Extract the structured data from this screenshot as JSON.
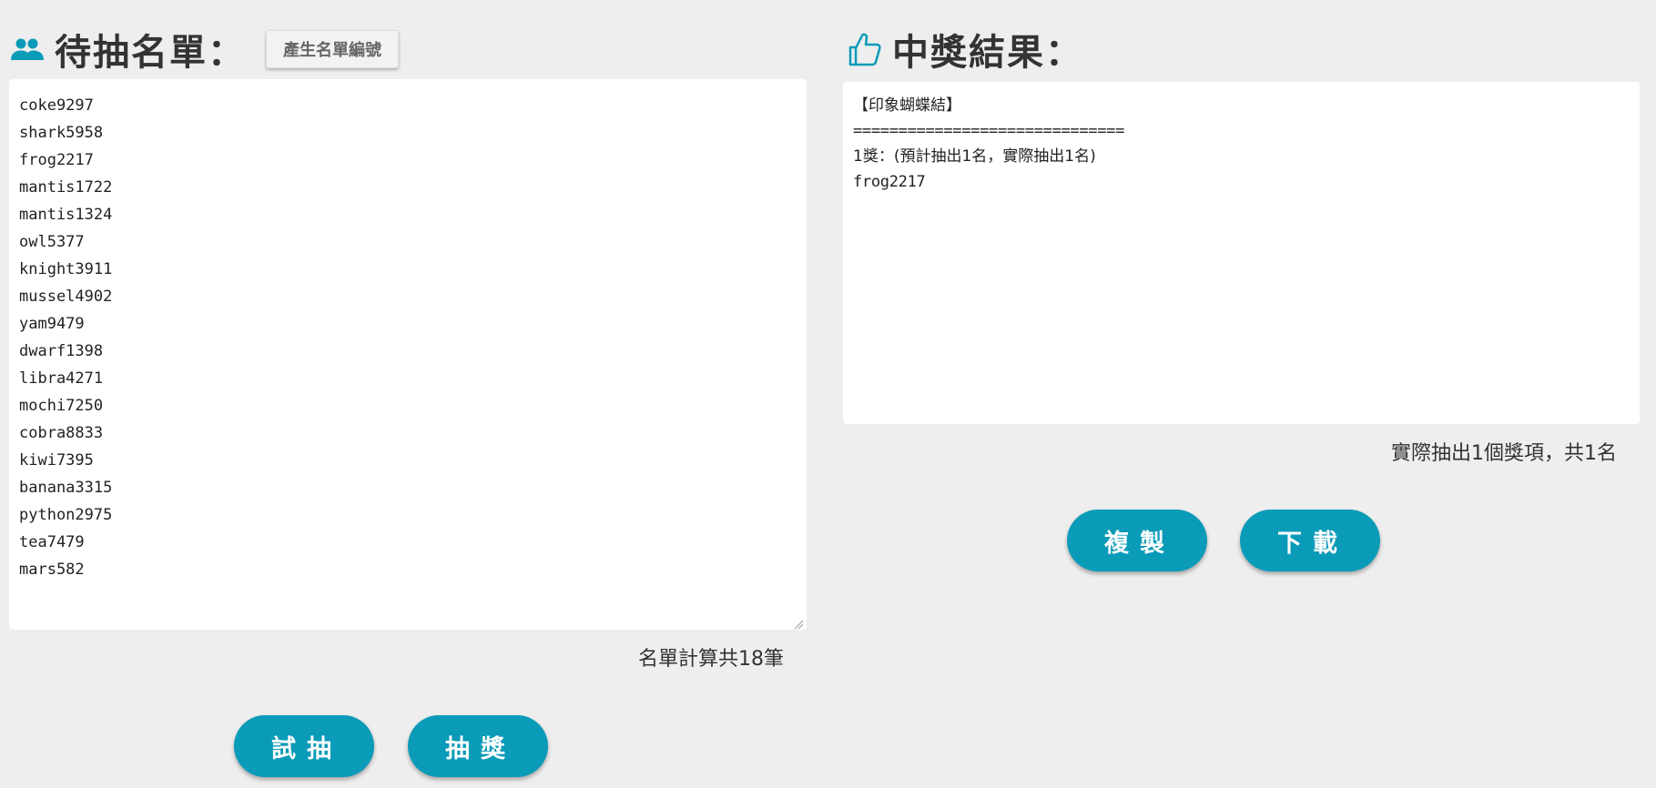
{
  "colors": {
    "accent": "#0a9bb8",
    "background": "#eeeeee",
    "box": "#ffffff"
  },
  "left": {
    "icon": "people-icon",
    "title": "待抽名單：",
    "generate_button": "產生名單編號",
    "names": [
      "coke9297",
      "shark5958",
      "frog2217",
      "mantis1722",
      "mantis1324",
      "owl5377",
      "knight3911",
      "mussel4902",
      "yam9479",
      "dwarf1398",
      "libra4271",
      "mochi7250",
      "cobra8833",
      "kiwi7395",
      "banana3315",
      "python2975",
      "tea7479",
      "mars582"
    ],
    "count_text": "名單計算共18筆",
    "try_button": "試抽",
    "draw_button": "抽獎"
  },
  "right": {
    "icon": "thumbs-up-icon",
    "title": "中獎結果：",
    "result_lines": [
      "【印象蝴蝶結】",
      "==============================",
      "1獎：(預計抽出1名，實際抽出1名)",
      "frog2217"
    ],
    "summary_text": "實際抽出1個獎項，共1名",
    "copy_button": "複製",
    "download_button": "下載"
  }
}
